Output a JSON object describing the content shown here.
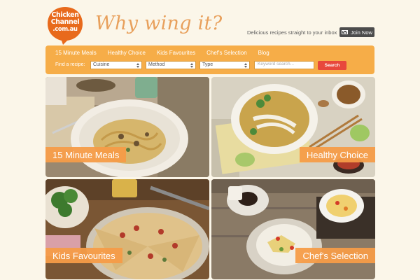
{
  "logo": {
    "line1": "Chicken",
    "line2": "Channel",
    "line3": ".com.au",
    "color": "#e86a1c"
  },
  "header": {
    "tagline": "Why wing it?",
    "newsletter_text": "Delicious recipes straight to your inbox",
    "join_label": "Join Now"
  },
  "nav": {
    "links": [
      "15 Minute Meals",
      "Healthy Choice",
      "Kids Favourites",
      "Chef's Selection",
      "Blog"
    ]
  },
  "search": {
    "find_label": "Find a recipe:",
    "cuisine": "Cuisine",
    "method": "Method",
    "type": "Type",
    "keyword_placeholder": "Keyword search...",
    "search_label": "Search"
  },
  "tiles": [
    {
      "label": "15 Minute Meals",
      "image": "pasta-dish-icon"
    },
    {
      "label": "Healthy Choice",
      "image": "noodle-soup-icon"
    },
    {
      "label": "Kids Favourites",
      "image": "pizza-icon"
    },
    {
      "label": "Chef's Selection",
      "image": "salad-bowl-icon"
    }
  ],
  "colors": {
    "accent": "#f6ad48",
    "label_bg": "#f69c48",
    "search_button": "#e8483c",
    "background": "#fbf6e9"
  }
}
